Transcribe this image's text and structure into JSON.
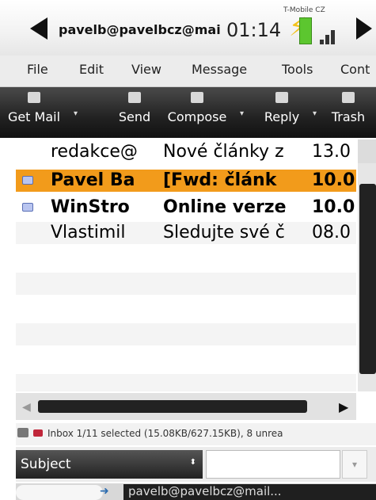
{
  "topbar": {
    "account": "pavelb@pavelbcz@mai",
    "time": "01:14",
    "carrier": "T-Mobile CZ"
  },
  "menu": [
    "File",
    "Edit",
    "View",
    "Message",
    "Tools",
    "Cont"
  ],
  "toolbar": [
    {
      "label": "Get Mail",
      "icon": "get-mail-icon"
    },
    {
      "label": "Send",
      "icon": "send-icon"
    },
    {
      "label": "Compose",
      "icon": "compose-icon"
    },
    {
      "label": "Reply",
      "icon": "reply-icon"
    },
    {
      "label": "Trash",
      "icon": "trash-icon"
    }
  ],
  "messages": [
    {
      "sender": "redakce@",
      "subject": "Nové články z",
      "date": "13.0",
      "bold": false,
      "selected": false,
      "unread": false
    },
    {
      "sender": "Pavel Ba",
      "subject": "[Fwd: článk",
      "date": "10.0",
      "bold": true,
      "selected": true,
      "unread": true
    },
    {
      "sender": "WinStro",
      "subject": "Online verze",
      "date": "10.0",
      "bold": true,
      "selected": false,
      "unread": true
    },
    {
      "sender": "Vlastimil",
      "subject": "Sledujte své č",
      "date": "08.0",
      "bold": false,
      "selected": false,
      "unread": false
    }
  ],
  "status": {
    "text": "Inbox  1/11 selected (15.08KB/627.15KB), 8 unrea"
  },
  "filter": {
    "field": "Subject",
    "search_value": ""
  },
  "taskbar": {
    "item": "pavelb@pavelbcz@mail..."
  },
  "colors": {
    "selected_row": "#f29b1b",
    "unread_flag": "#5a6fb5",
    "toolbar_bg": "#222222"
  }
}
